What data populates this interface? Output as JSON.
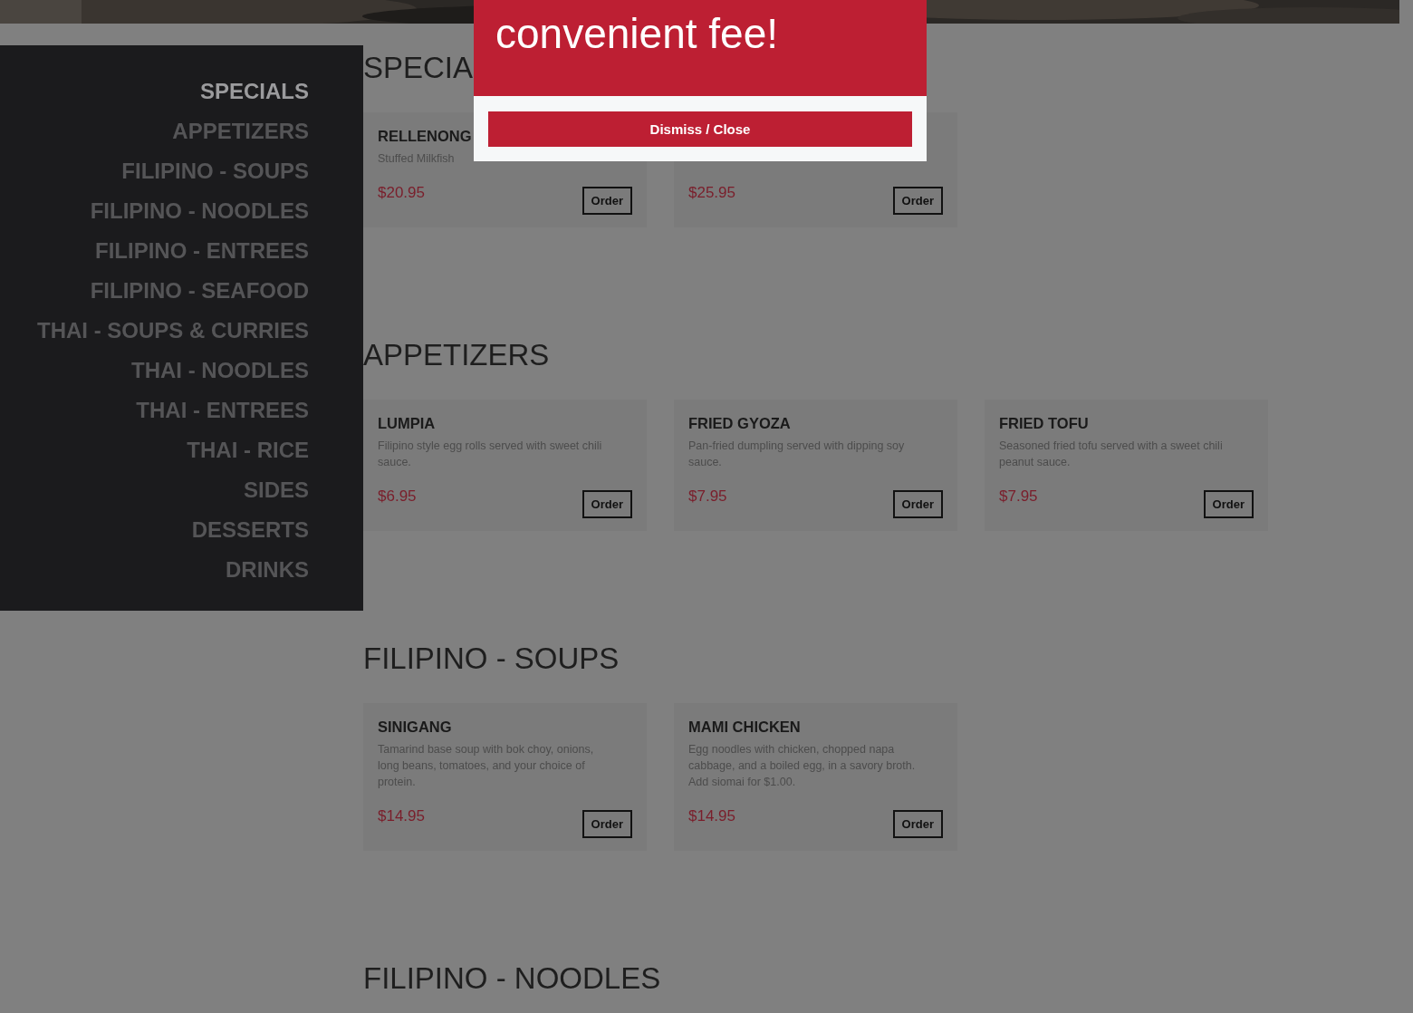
{
  "sidebar": {
    "items": [
      {
        "label": "SPECIALS",
        "selected": true
      },
      {
        "label": "APPETIZERS",
        "selected": false
      },
      {
        "label": "FILIPINO - SOUPS",
        "selected": false
      },
      {
        "label": "FILIPINO - NOODLES",
        "selected": false
      },
      {
        "label": "FILIPINO - ENTREES",
        "selected": false
      },
      {
        "label": "FILIPINO - SEAFOOD",
        "selected": false
      },
      {
        "label": "THAI - SOUPS & CURRIES",
        "selected": false
      },
      {
        "label": "THAI - NOODLES",
        "selected": false
      },
      {
        "label": "THAI - ENTREES",
        "selected": false
      },
      {
        "label": "THAI - RICE",
        "selected": false
      },
      {
        "label": "SIDES",
        "selected": false
      },
      {
        "label": "DESSERTS",
        "selected": false
      },
      {
        "label": "DRINKS",
        "selected": false
      }
    ]
  },
  "sections": [
    {
      "title": "SPECIA",
      "items": [
        {
          "name": "RELLENONG",
          "description": "Stuffed Milkfish",
          "price": "$20.95",
          "button": "Order"
        },
        {
          "price": "$25.95",
          "button": "Order"
        }
      ]
    },
    {
      "title": "APPETIZERS",
      "items": [
        {
          "name": "LUMPIA",
          "description": "Filipino style egg rolls served with sweet chili sauce.",
          "price": "$6.95",
          "button": "Order"
        },
        {
          "name": "FRIED GYOZA",
          "description": "Pan-fried dumpling served with dipping soy sauce.",
          "price": "$7.95",
          "button": "Order"
        },
        {
          "name": "FRIED TOFU",
          "description": "Seasoned fried tofu served with a sweet chili peanut sauce.",
          "price": "$7.95",
          "button": "Order"
        }
      ]
    },
    {
      "title": "FILIPINO - SOUPS",
      "items": [
        {
          "name": "SINIGANG",
          "description": "Tamarind base soup with bok choy, onions, long beans, tomatoes, and your choice of protein.",
          "price": "$14.95",
          "button": "Order"
        },
        {
          "name": "MAMI CHICKEN",
          "description": "Egg noodles with chicken, chopped napa cabbage, and a boiled egg, in a savory broth. Add siomai for $1.00.",
          "price": "$14.95",
          "button": "Order"
        }
      ]
    },
    {
      "title": "FILIPINO - NOODLES"
    }
  ],
  "modal": {
    "message": "convenient fee!",
    "button": "Dismiss / Close"
  }
}
